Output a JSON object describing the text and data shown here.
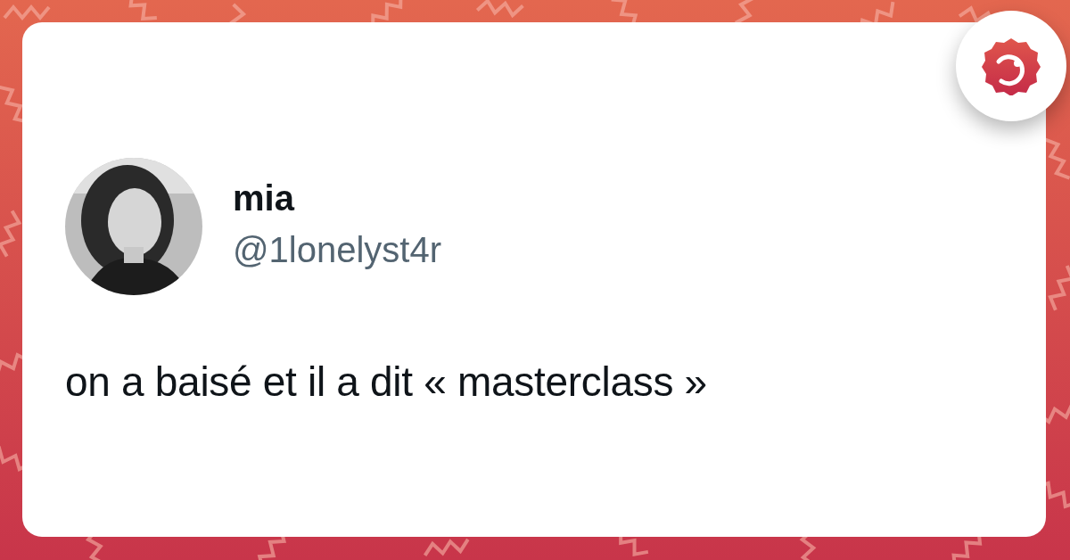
{
  "author": {
    "name": "mia",
    "handle": "@1lonelyst4r"
  },
  "tweet": {
    "text": "on a baisé et il a dit « masterclass »"
  }
}
